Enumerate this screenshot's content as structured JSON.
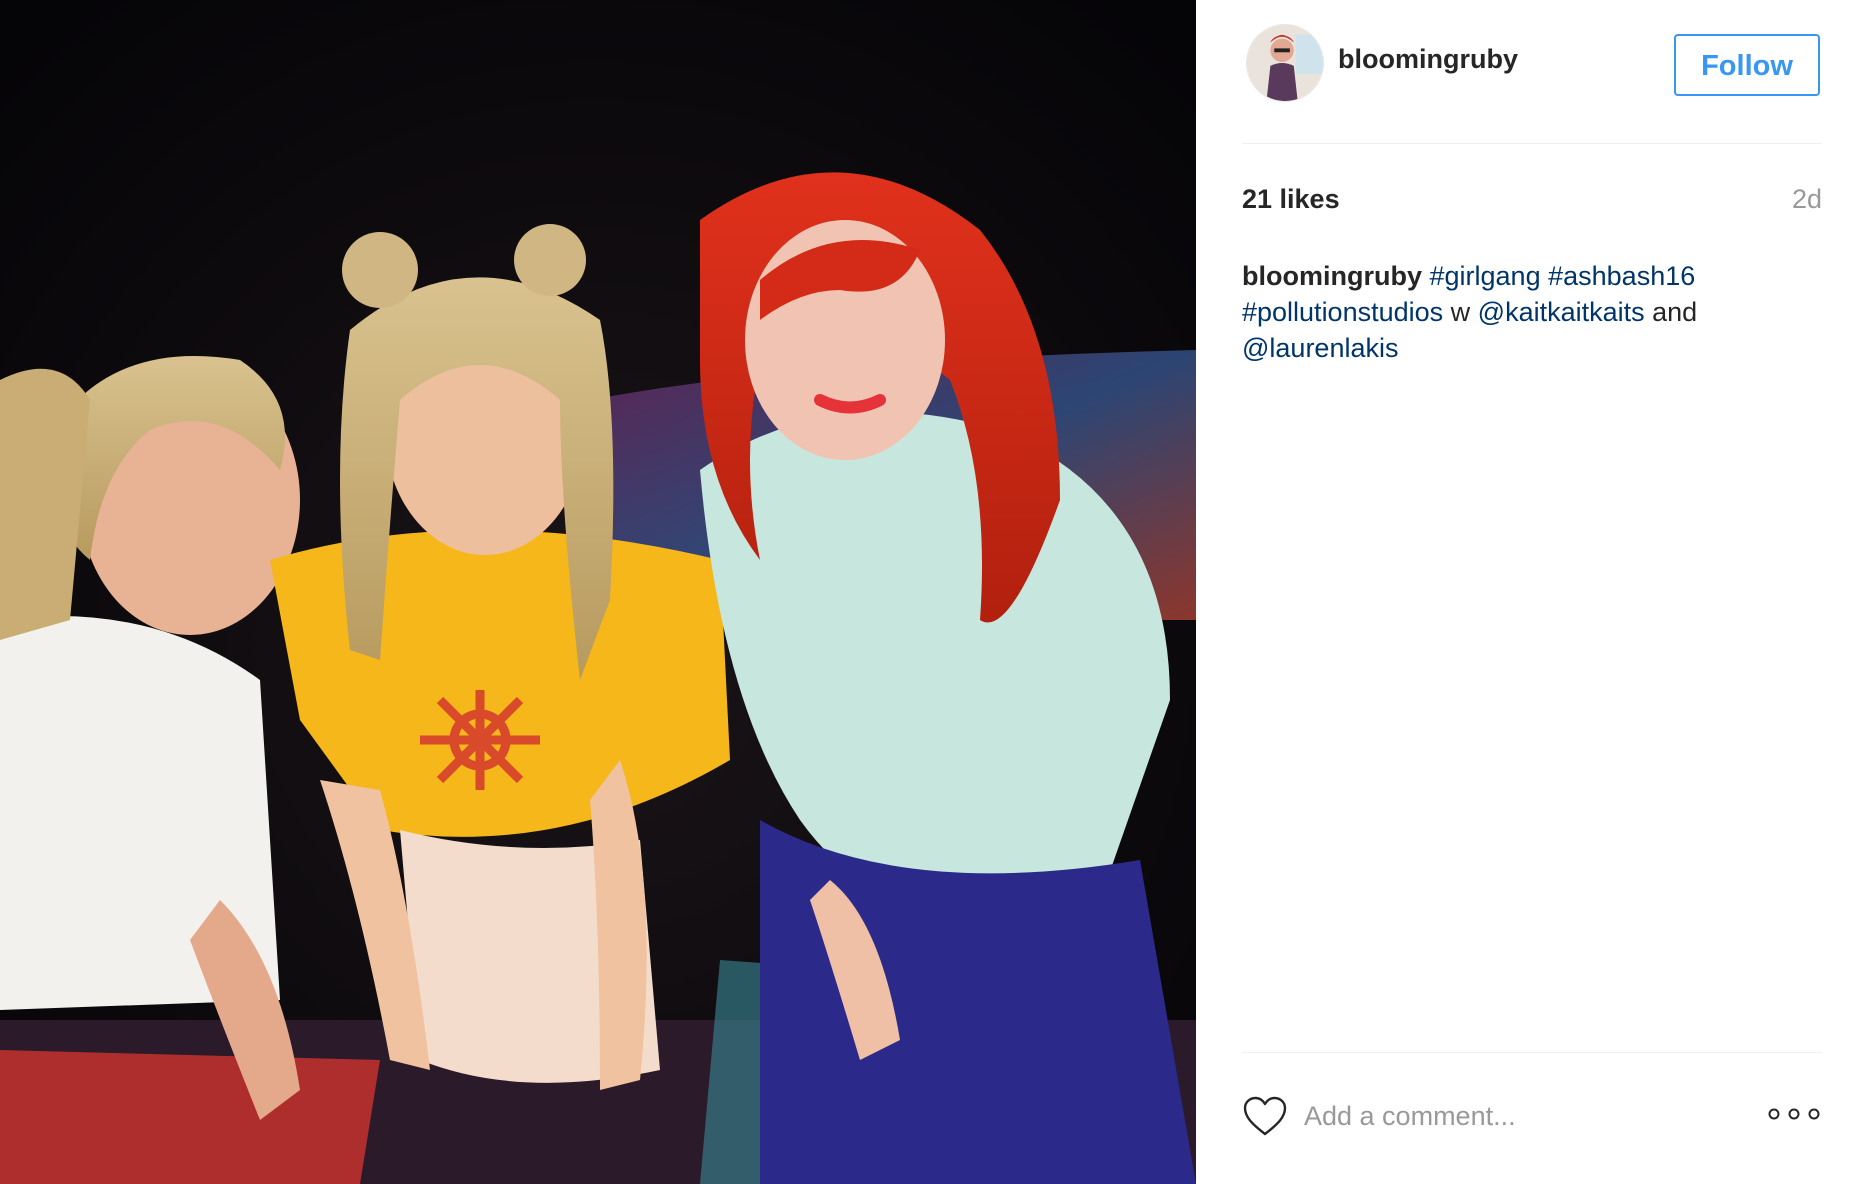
{
  "post": {
    "username": "bloomingruby",
    "follow_label": "Follow",
    "likes": "21 likes",
    "timestamp": "2d",
    "caption": {
      "username": "bloomingruby",
      "parts": [
        {
          "text": "#girlgang",
          "kind": "hashtag"
        },
        {
          "text": " ",
          "kind": "text"
        },
        {
          "text": "#ashbash16",
          "kind": "hashtag"
        },
        {
          "text": " ",
          "kind": "text"
        },
        {
          "text": "#pollutionstudios",
          "kind": "hashtag"
        },
        {
          "text": " w ",
          "kind": "text"
        },
        {
          "text": "@kaitkaitkaits",
          "kind": "mention"
        },
        {
          "text": " and ",
          "kind": "text"
        },
        {
          "text": "@laurenlakis",
          "kind": "mention"
        }
      ]
    },
    "comment_placeholder": "Add a comment...",
    "icons": {
      "like": "heart-outline-icon",
      "more": "three-dots-icon"
    },
    "colors": {
      "accent": "#3897f0",
      "hashtag": "#003569",
      "text": "#262626",
      "muted": "#999999"
    }
  }
}
